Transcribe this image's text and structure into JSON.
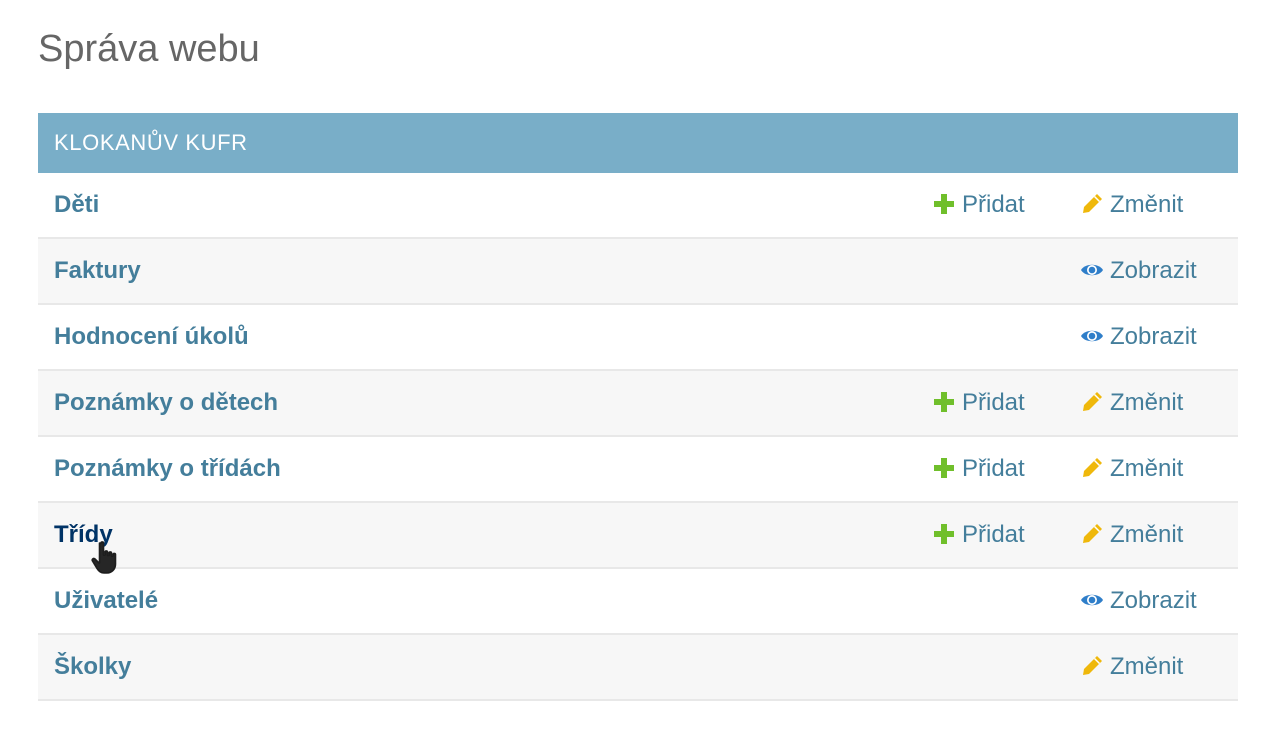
{
  "page": {
    "title": "Správa webu"
  },
  "module": {
    "caption": "KLOKANŮV KUFR",
    "rows": [
      {
        "name": "Děti",
        "add": "Přidat",
        "change": "Změnit",
        "view": ""
      },
      {
        "name": "Faktury",
        "add": "",
        "change": "",
        "view": "Zobrazit"
      },
      {
        "name": "Hodnocení úkolů",
        "add": "",
        "change": "",
        "view": "Zobrazit"
      },
      {
        "name": "Poznámky o dětech",
        "add": "Přidat",
        "change": "Změnit",
        "view": ""
      },
      {
        "name": "Poznámky o třídách",
        "add": "Přidat",
        "change": "Změnit",
        "view": ""
      },
      {
        "name": "Třídy",
        "add": "Přidat",
        "change": "Změnit",
        "view": ""
      },
      {
        "name": "Uživatelé",
        "add": "",
        "change": "",
        "view": "Zobrazit"
      },
      {
        "name": "Školky",
        "add": "",
        "change": "Změnit",
        "view": ""
      }
    ]
  },
  "colors": {
    "caption_bg": "#79aec8",
    "link": "#447e9b",
    "link_hover": "#003366",
    "add_icon": "#70bf2b",
    "change_icon": "#efb80b",
    "view_icon": "#2f7ec9"
  },
  "icons": {
    "add": "plus-icon",
    "change": "pencil-icon",
    "view": "eye-icon"
  }
}
